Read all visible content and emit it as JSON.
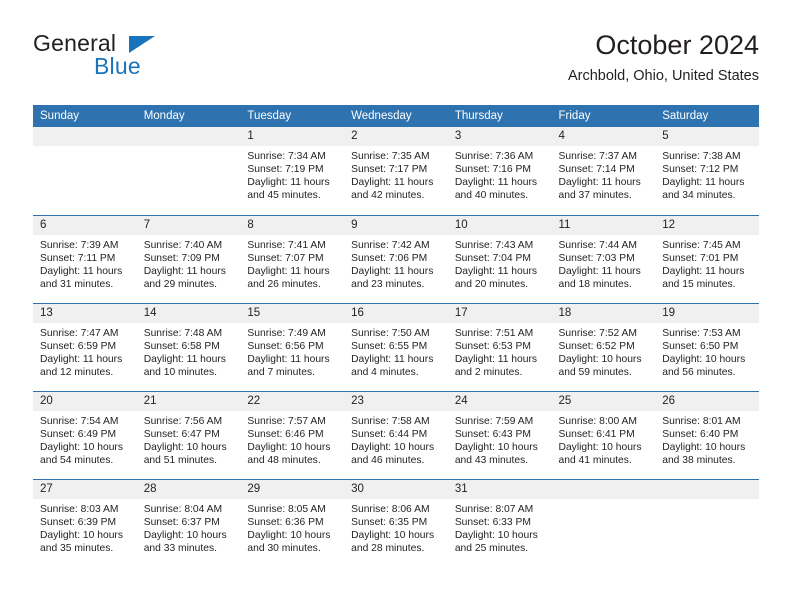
{
  "logo": {
    "word1": "General",
    "word2": "Blue",
    "triangle_color": "#1a74bb"
  },
  "header": {
    "title": "October 2024",
    "subtitle": "Archbold, Ohio, United States"
  },
  "theme": {
    "header_blue": "#2e72b0",
    "daynum_band": "#f0f0f0",
    "text": "#231f20"
  },
  "weekday_headers": [
    "Sunday",
    "Monday",
    "Tuesday",
    "Wednesday",
    "Thursday",
    "Friday",
    "Saturday"
  ],
  "labels": {
    "sunrise_prefix": "Sunrise:",
    "sunset_prefix": "Sunset:",
    "daylight_prefix": "Daylight:"
  },
  "weeks": [
    [
      {
        "day": "",
        "lines": []
      },
      {
        "day": "",
        "lines": []
      },
      {
        "day": "1",
        "lines": [
          "Sunrise: 7:34 AM",
          "Sunset: 7:19 PM",
          "Daylight: 11 hours",
          "and 45 minutes."
        ]
      },
      {
        "day": "2",
        "lines": [
          "Sunrise: 7:35 AM",
          "Sunset: 7:17 PM",
          "Daylight: 11 hours",
          "and 42 minutes."
        ]
      },
      {
        "day": "3",
        "lines": [
          "Sunrise: 7:36 AM",
          "Sunset: 7:16 PM",
          "Daylight: 11 hours",
          "and 40 minutes."
        ]
      },
      {
        "day": "4",
        "lines": [
          "Sunrise: 7:37 AM",
          "Sunset: 7:14 PM",
          "Daylight: 11 hours",
          "and 37 minutes."
        ]
      },
      {
        "day": "5",
        "lines": [
          "Sunrise: 7:38 AM",
          "Sunset: 7:12 PM",
          "Daylight: 11 hours",
          "and 34 minutes."
        ]
      }
    ],
    [
      {
        "day": "6",
        "lines": [
          "Sunrise: 7:39 AM",
          "Sunset: 7:11 PM",
          "Daylight: 11 hours",
          "and 31 minutes."
        ]
      },
      {
        "day": "7",
        "lines": [
          "Sunrise: 7:40 AM",
          "Sunset: 7:09 PM",
          "Daylight: 11 hours",
          "and 29 minutes."
        ]
      },
      {
        "day": "8",
        "lines": [
          "Sunrise: 7:41 AM",
          "Sunset: 7:07 PM",
          "Daylight: 11 hours",
          "and 26 minutes."
        ]
      },
      {
        "day": "9",
        "lines": [
          "Sunrise: 7:42 AM",
          "Sunset: 7:06 PM",
          "Daylight: 11 hours",
          "and 23 minutes."
        ]
      },
      {
        "day": "10",
        "lines": [
          "Sunrise: 7:43 AM",
          "Sunset: 7:04 PM",
          "Daylight: 11 hours",
          "and 20 minutes."
        ]
      },
      {
        "day": "11",
        "lines": [
          "Sunrise: 7:44 AM",
          "Sunset: 7:03 PM",
          "Daylight: 11 hours",
          "and 18 minutes."
        ]
      },
      {
        "day": "12",
        "lines": [
          "Sunrise: 7:45 AM",
          "Sunset: 7:01 PM",
          "Daylight: 11 hours",
          "and 15 minutes."
        ]
      }
    ],
    [
      {
        "day": "13",
        "lines": [
          "Sunrise: 7:47 AM",
          "Sunset: 6:59 PM",
          "Daylight: 11 hours",
          "and 12 minutes."
        ]
      },
      {
        "day": "14",
        "lines": [
          "Sunrise: 7:48 AM",
          "Sunset: 6:58 PM",
          "Daylight: 11 hours",
          "and 10 minutes."
        ]
      },
      {
        "day": "15",
        "lines": [
          "Sunrise: 7:49 AM",
          "Sunset: 6:56 PM",
          "Daylight: 11 hours",
          "and 7 minutes."
        ]
      },
      {
        "day": "16",
        "lines": [
          "Sunrise: 7:50 AM",
          "Sunset: 6:55 PM",
          "Daylight: 11 hours",
          "and 4 minutes."
        ]
      },
      {
        "day": "17",
        "lines": [
          "Sunrise: 7:51 AM",
          "Sunset: 6:53 PM",
          "Daylight: 11 hours",
          "and 2 minutes."
        ]
      },
      {
        "day": "18",
        "lines": [
          "Sunrise: 7:52 AM",
          "Sunset: 6:52 PM",
          "Daylight: 10 hours",
          "and 59 minutes."
        ]
      },
      {
        "day": "19",
        "lines": [
          "Sunrise: 7:53 AM",
          "Sunset: 6:50 PM",
          "Daylight: 10 hours",
          "and 56 minutes."
        ]
      }
    ],
    [
      {
        "day": "20",
        "lines": [
          "Sunrise: 7:54 AM",
          "Sunset: 6:49 PM",
          "Daylight: 10 hours",
          "and 54 minutes."
        ]
      },
      {
        "day": "21",
        "lines": [
          "Sunrise: 7:56 AM",
          "Sunset: 6:47 PM",
          "Daylight: 10 hours",
          "and 51 minutes."
        ]
      },
      {
        "day": "22",
        "lines": [
          "Sunrise: 7:57 AM",
          "Sunset: 6:46 PM",
          "Daylight: 10 hours",
          "and 48 minutes."
        ]
      },
      {
        "day": "23",
        "lines": [
          "Sunrise: 7:58 AM",
          "Sunset: 6:44 PM",
          "Daylight: 10 hours",
          "and 46 minutes."
        ]
      },
      {
        "day": "24",
        "lines": [
          "Sunrise: 7:59 AM",
          "Sunset: 6:43 PM",
          "Daylight: 10 hours",
          "and 43 minutes."
        ]
      },
      {
        "day": "25",
        "lines": [
          "Sunrise: 8:00 AM",
          "Sunset: 6:41 PM",
          "Daylight: 10 hours",
          "and 41 minutes."
        ]
      },
      {
        "day": "26",
        "lines": [
          "Sunrise: 8:01 AM",
          "Sunset: 6:40 PM",
          "Daylight: 10 hours",
          "and 38 minutes."
        ]
      }
    ],
    [
      {
        "day": "27",
        "lines": [
          "Sunrise: 8:03 AM",
          "Sunset: 6:39 PM",
          "Daylight: 10 hours",
          "and 35 minutes."
        ]
      },
      {
        "day": "28",
        "lines": [
          "Sunrise: 8:04 AM",
          "Sunset: 6:37 PM",
          "Daylight: 10 hours",
          "and 33 minutes."
        ]
      },
      {
        "day": "29",
        "lines": [
          "Sunrise: 8:05 AM",
          "Sunset: 6:36 PM",
          "Daylight: 10 hours",
          "and 30 minutes."
        ]
      },
      {
        "day": "30",
        "lines": [
          "Sunrise: 8:06 AM",
          "Sunset: 6:35 PM",
          "Daylight: 10 hours",
          "and 28 minutes."
        ]
      },
      {
        "day": "31",
        "lines": [
          "Sunrise: 8:07 AM",
          "Sunset: 6:33 PM",
          "Daylight: 10 hours",
          "and 25 minutes."
        ]
      },
      {
        "day": "",
        "lines": []
      },
      {
        "day": "",
        "lines": []
      }
    ]
  ]
}
